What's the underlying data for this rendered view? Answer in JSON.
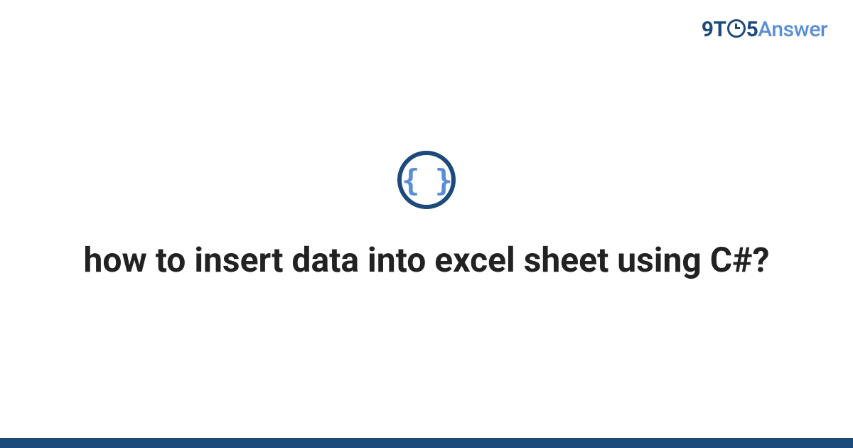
{
  "logo": {
    "part1": "9T",
    "part2": "5",
    "part3": "Answer"
  },
  "icon": {
    "name": "code-braces",
    "glyph": "{ }"
  },
  "title": "how to insert data into excel sheet using C#?",
  "colors": {
    "primary_dark": "#1c4a7a",
    "primary_light": "#5a8fd6"
  }
}
